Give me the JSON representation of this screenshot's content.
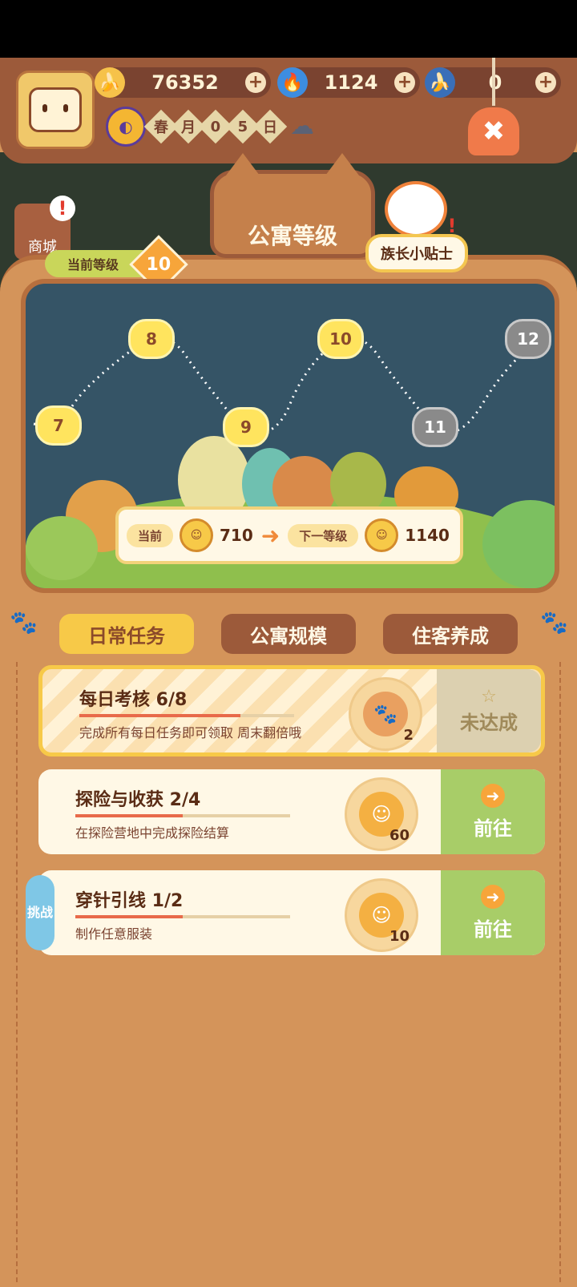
{
  "header": {
    "currencies": [
      {
        "icon": "banana-icon",
        "value": "76352"
      },
      {
        "icon": "flame-icon",
        "value": "1124"
      },
      {
        "icon": "blue-banana-icon",
        "value": "0"
      }
    ],
    "date": [
      "春",
      "月",
      "0",
      "5",
      "日"
    ],
    "shop_label": "商城"
  },
  "panel": {
    "title": "公寓等级",
    "chief_tip": "族长小贴士",
    "current_level_label": "当前等级",
    "current_level": "10"
  },
  "map": {
    "nodes": [
      {
        "label": "7",
        "locked": false
      },
      {
        "label": "8",
        "locked": false
      },
      {
        "label": "9",
        "locked": false
      },
      {
        "label": "10",
        "locked": false
      },
      {
        "label": "11",
        "locked": true
      },
      {
        "label": "12",
        "locked": true
      }
    ]
  },
  "exp": {
    "current_label": "当前",
    "current_value": "710",
    "next_label": "下一等级",
    "next_value": "1140"
  },
  "tabs": [
    "日常任务",
    "公寓规模",
    "住客养成"
  ],
  "tasks": [
    {
      "title": "每日考核  6/8",
      "progress": 0.75,
      "desc": "完成所有每日任务即可领取 周末翻倍哦",
      "reward_qty": "2",
      "action": "未达成"
    },
    {
      "title": "探险与收获  2/4",
      "progress": 0.5,
      "desc": "在探险营地中完成探险结算",
      "reward_qty": "60",
      "action": "前往"
    },
    {
      "title": "穿针引线  1/2",
      "progress": 0.5,
      "desc": "制作任意服装",
      "reward_qty": "10",
      "action": "前往",
      "badge": "挑战"
    }
  ],
  "colors": {
    "accent": "#f7c948",
    "panel": "#d4945a",
    "go": "#a8cd68"
  }
}
